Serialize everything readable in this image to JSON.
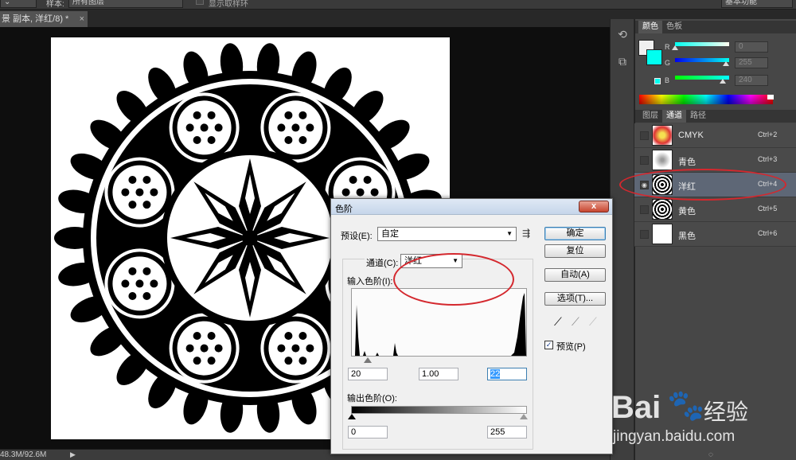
{
  "options_bar": {
    "sample_label": "样本:",
    "sample_value": "所有图层",
    "show_ring_label": "显示取样环",
    "workspace": "基本功能"
  },
  "document": {
    "tab_title": "景 副本, 洋红/8) *",
    "close": "×"
  },
  "status_bar": {
    "doc_size": "48.3M/92.6M"
  },
  "color_panel": {
    "tabs": [
      "颜色",
      "色板"
    ],
    "r_label": "R",
    "g_label": "G",
    "b_label": "B",
    "r_value": "0",
    "g_value": "255",
    "b_value": "240",
    "r_level": 0.0,
    "g_level": 1.0,
    "b_level": 0.94
  },
  "channels_panel": {
    "tabs": [
      "图层",
      "通道",
      "路径"
    ],
    "channels": [
      {
        "name": "CMYK",
        "shortcut": "Ctrl+2",
        "selected": false
      },
      {
        "name": "青色",
        "shortcut": "Ctrl+3",
        "selected": false
      },
      {
        "name": "洋红",
        "shortcut": "Ctrl+4",
        "selected": true
      },
      {
        "name": "黄色",
        "shortcut": "Ctrl+5",
        "selected": false
      },
      {
        "name": "黑色",
        "shortcut": "Ctrl+6",
        "selected": false
      }
    ]
  },
  "levels_dialog": {
    "title": "色阶",
    "close": "x",
    "preset_label": "预设(E):",
    "preset_value": "自定",
    "channel_label": "通道(C):",
    "channel_value": "洋红",
    "input_levels_label": "输入色阶(I):",
    "input_black": "20",
    "input_gamma": "1.00",
    "input_white": "22",
    "output_levels_label": "输出色阶(O):",
    "output_black": "0",
    "output_white": "255",
    "buttons": {
      "ok": "确定",
      "reset": "复位",
      "auto": "自动(A)",
      "options": "选项(T)..."
    },
    "preview_label": "预览(P)",
    "preview_checked": true
  },
  "watermark": {
    "brand_left": "Bai",
    "brand_right": "经验",
    "url": "jingyan.baidu.com"
  },
  "colors": {
    "annotation": "#d4282e",
    "selected_row": "#5e6776"
  }
}
